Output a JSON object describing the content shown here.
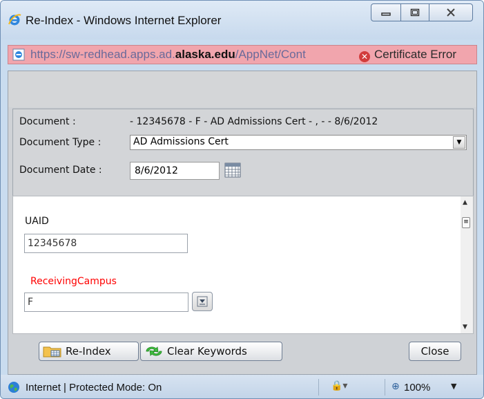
{
  "window": {
    "title": "Re-Index - Windows Internet Explorer"
  },
  "address": {
    "url_pre": "https://sw-redhead.apps.ad.",
    "url_domain": "alaska.edu",
    "url_post": "/AppNet/Cont",
    "cert_error": "Certificate Error"
  },
  "document": {
    "label": "Document :",
    "value": "- 12345678 - F - AD Admissions Cert - , - - 8/6/2012",
    "type_label": "Document Type :",
    "type_value": "AD Admissions Cert",
    "date_label": "Document Date :",
    "date_value": "8/6/2012"
  },
  "keywords": {
    "uaid_label": "UAID",
    "uaid_value": "12345678",
    "campus_label": "ReceivingCampus",
    "campus_value": "F",
    "campus_label_color": "#ff0000"
  },
  "buttons": {
    "reindex": "Re-Index",
    "clear": "Clear Keywords",
    "close": "Close"
  },
  "status": {
    "text": "Internet | Protected Mode: On",
    "zoom": "100%"
  }
}
